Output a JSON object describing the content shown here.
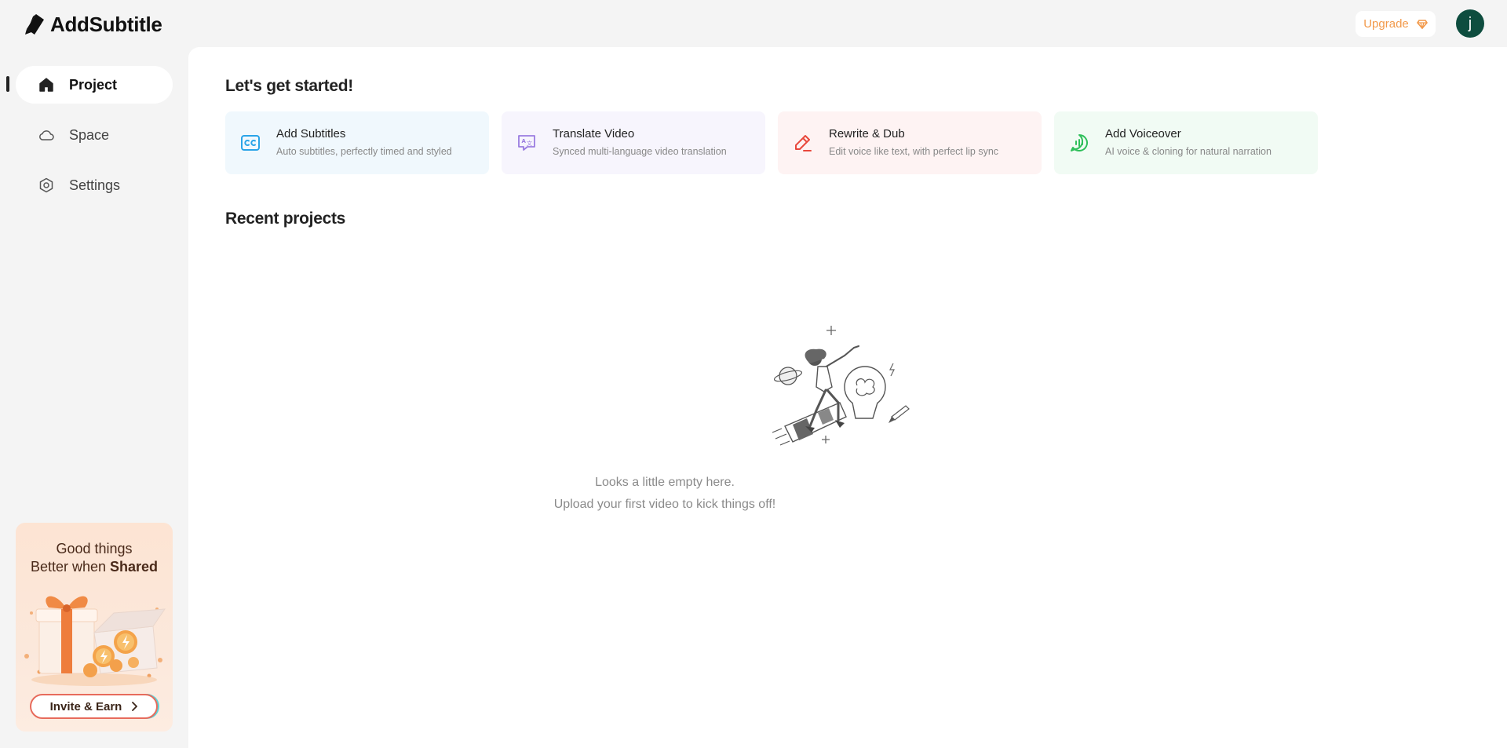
{
  "app": {
    "name": "AddSubtitle"
  },
  "header": {
    "upgrade_label": "Upgrade",
    "avatar_initial": "j",
    "avatar_color": "#0e4d3f",
    "upgrade_color": "#f2994a"
  },
  "sidebar": {
    "items": [
      {
        "label": "Project",
        "icon": "home-icon",
        "active": true
      },
      {
        "label": "Space",
        "icon": "cloud-icon",
        "active": false
      },
      {
        "label": "Settings",
        "icon": "settings-icon",
        "active": false
      }
    ],
    "promo": {
      "line1": "Good things",
      "line2_prefix": "Better when ",
      "line2_bold": "Shared",
      "button_label": "Invite & Earn"
    }
  },
  "main": {
    "heading": "Let's get started!",
    "actions": [
      {
        "title": "Add Subtitles",
        "subtitle": "Auto subtitles, perfectly timed and styled",
        "icon": "cc-icon",
        "bg": "#f0f8fd",
        "accent": "#2aa4e8"
      },
      {
        "title": "Translate Video",
        "subtitle": "Synced multi-language video translation",
        "icon": "translate-icon",
        "bg": "#f7f5fd",
        "accent": "#9a7ce0"
      },
      {
        "title": "Rewrite & Dub",
        "subtitle": "Edit voice like text, with perfect lip sync",
        "icon": "pen-icon",
        "bg": "#fef3f3",
        "accent": "#e8483c"
      },
      {
        "title": "Add Voiceover",
        "subtitle": "AI voice & cloning for natural narration",
        "icon": "voice-icon",
        "bg": "#f1fbf4",
        "accent": "#2fbf5a"
      }
    ],
    "recent_heading": "Recent projects",
    "empty_line1": "Looks a little empty here.",
    "empty_line2": "Upload your first video to kick things off!"
  }
}
